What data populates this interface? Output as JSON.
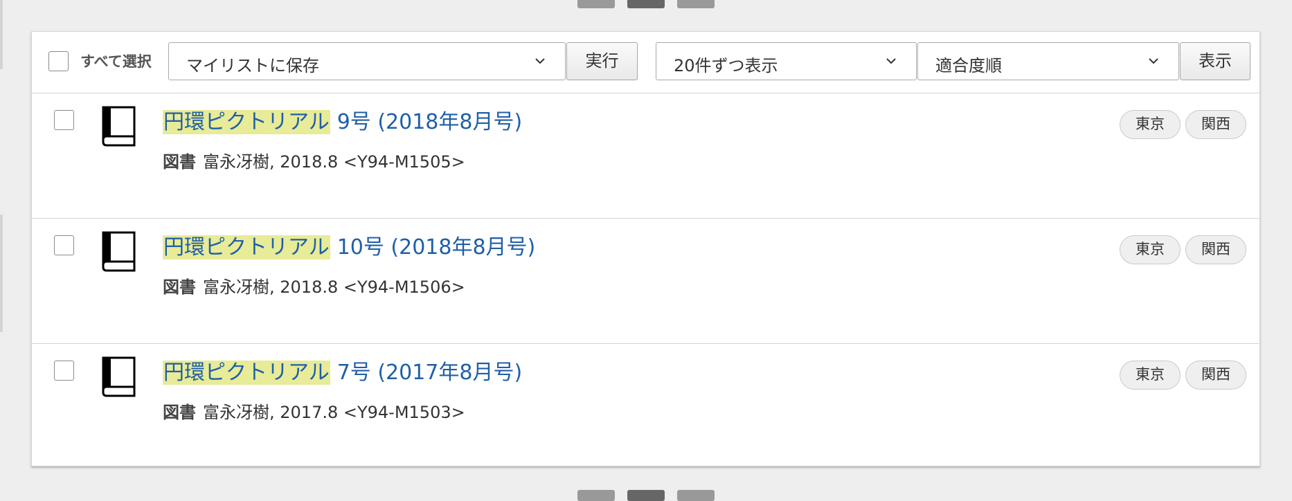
{
  "toolbar": {
    "select_all_label": "すべて選択",
    "action_select": "マイリストに保存",
    "execute_button": "実行",
    "per_page_select": "20件ずつ表示",
    "sort_select": "適合度順",
    "display_button": "表示"
  },
  "results": [
    {
      "title_highlight": "円環ピクトリアル",
      "title_rest": "9号 (2018年8月号)",
      "type": "図書",
      "details": "富永冴樹, 2018.8 <Y94-M1505>",
      "tags": [
        "東京",
        "関西"
      ]
    },
    {
      "title_highlight": "円環ピクトリアル",
      "title_rest": "10号 (2018年8月号)",
      "type": "図書",
      "details": "富永冴樹, 2018.8 <Y94-M1506>",
      "tags": [
        "東京",
        "関西"
      ]
    },
    {
      "title_highlight": "円環ピクトリアル",
      "title_rest": "7号 (2017年8月号)",
      "type": "図書",
      "details": "富永冴樹, 2017.8 <Y94-M1503>",
      "tags": [
        "東京",
        "関西"
      ]
    }
  ],
  "icons": {
    "result_type": "book-icon",
    "dropdown": "chevron-down-icon"
  },
  "colors": {
    "link": "#1f5fa8",
    "highlight": "#e8eb97"
  }
}
